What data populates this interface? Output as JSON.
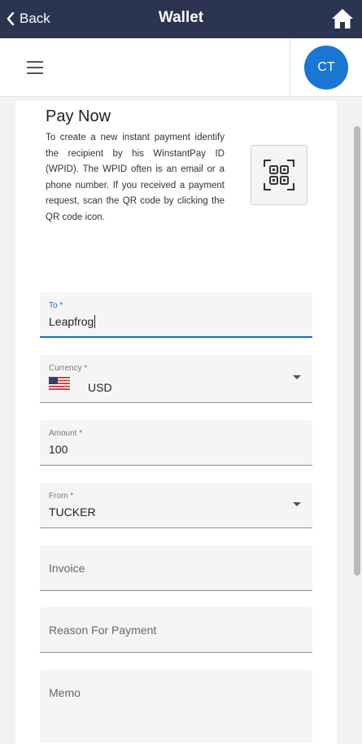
{
  "topbar": {
    "back_label": "Back",
    "title": "Wallet"
  },
  "header": {
    "avatar_initials": "CT"
  },
  "pay": {
    "title": "Pay Now",
    "description": "To create a new instant payment identify the recipient by his WinstantPay ID (WPID). The WPID often is an email or a phone number. If you received a payment request, scan the QR code by clicking the QR code icon."
  },
  "form": {
    "to": {
      "label": "To *",
      "value": "Leapfrog"
    },
    "currency": {
      "label": "Currency *",
      "value": "USD"
    },
    "amount": {
      "label": "Amount *",
      "value": "100"
    },
    "from": {
      "label": "From *",
      "value": "TUCKER"
    },
    "invoice": {
      "label": "Invoice"
    },
    "reason": {
      "label": "Reason For Payment"
    },
    "memo": {
      "label": "Memo"
    }
  },
  "colors": {
    "nav_bg": "#2b3450",
    "accent": "#1976d2",
    "focus": "#1d6fc4"
  },
  "icons": [
    "chevron-left-icon",
    "home-icon",
    "hamburger-menu-icon",
    "qr-code-icon",
    "us-flag-icon",
    "dropdown-arrow-icon"
  ]
}
